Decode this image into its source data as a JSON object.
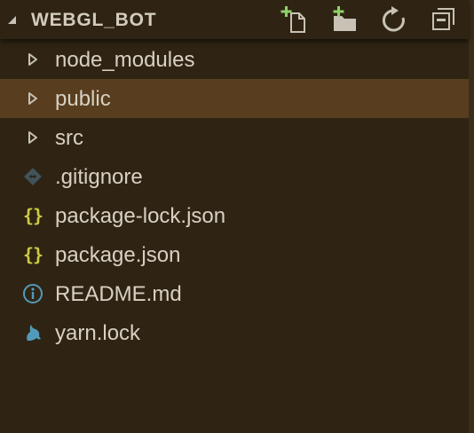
{
  "colors": {
    "background": "#2f2413",
    "selected_row": "#583e1f",
    "text": "#d7d0c3",
    "icon": "#c7c2b5",
    "add_plus": "#8fd16a",
    "json_icon": "#cbcb41",
    "git_icon": "#41535b",
    "info_icon": "#519aba",
    "yarn_icon": "#519aba"
  },
  "explorer": {
    "folder_name": "WEBGL_BOT",
    "expanded": true,
    "actions": [
      {
        "name": "new-file",
        "icon": "new-file-icon"
      },
      {
        "name": "new-folder",
        "icon": "new-folder-icon"
      },
      {
        "name": "refresh",
        "icon": "refresh-icon"
      },
      {
        "name": "collapse-all",
        "icon": "collapse-all-icon"
      }
    ],
    "items": [
      {
        "label": "node_modules",
        "kind": "folder",
        "icon": "chevron-right-icon",
        "selected": false
      },
      {
        "label": "public",
        "kind": "folder",
        "icon": "chevron-right-icon",
        "selected": true
      },
      {
        "label": "src",
        "kind": "folder",
        "icon": "chevron-right-icon",
        "selected": false
      },
      {
        "label": ".gitignore",
        "kind": "file",
        "icon": "git-icon",
        "selected": false
      },
      {
        "label": "package-lock.json",
        "kind": "file",
        "icon": "json-icon",
        "icon_text": "{}",
        "selected": false
      },
      {
        "label": "package.json",
        "kind": "file",
        "icon": "json-icon",
        "icon_text": "{}",
        "selected": false
      },
      {
        "label": "README.md",
        "kind": "file",
        "icon": "info-icon",
        "selected": false
      },
      {
        "label": "yarn.lock",
        "kind": "file",
        "icon": "yarn-icon",
        "selected": false
      }
    ]
  }
}
